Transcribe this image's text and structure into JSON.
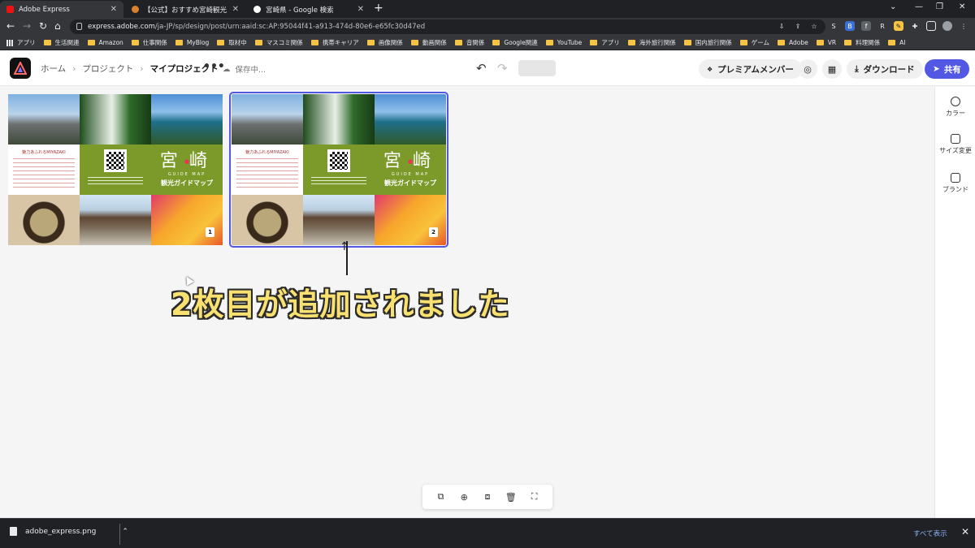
{
  "browser": {
    "tabs": [
      {
        "title": "Adobe Express",
        "active": true
      },
      {
        "title": "【公式】おすすめ宮崎観光スポット／..."
      },
      {
        "title": "宮崎県 - Google 検索"
      }
    ],
    "url_host": "express.adobe.com",
    "url_path": "/ja-JP/sp/design/post/urn:aaid:sc:AP:95044f41-a913-474d-80e6-e65fc30d47ed",
    "bookmarks": [
      "アプリ",
      "生活関連",
      "Amazon",
      "仕事関係",
      "MyBlog",
      "取材中",
      "マスコミ関係",
      "携帯キャリア",
      "画像関係",
      "動画関係",
      "音関係",
      "Google関連",
      "YouTube",
      "アプリ",
      "海外旅行関係",
      "国内旅行関係",
      "ゲーム",
      "Adobe",
      "VR",
      "料理関係",
      "AI"
    ]
  },
  "header": {
    "breadcrumbs": [
      "ホーム",
      "プロジェクト",
      "マイプロジェクト"
    ],
    "more_label": "•••",
    "saving_text": "保存中...",
    "premium_label": "プレミアムメンバー",
    "download_label": "ダウンロード",
    "share_label": "共有"
  },
  "right_panel": {
    "items": [
      "カラー",
      "サイズ変更",
      "ブランド"
    ]
  },
  "pages": [
    {
      "number": "1"
    },
    {
      "number": "2"
    }
  ],
  "design": {
    "title_top": "宮",
    "title_bottom": "崎",
    "guide_en": "GUIDE MAP",
    "guide_ja": "観光ガイドマップ",
    "catch": "魅力あふれるMIYAZAKI"
  },
  "annotation": {
    "arrow": "↑",
    "text": "2枚目が追加されました"
  },
  "download_shelf": {
    "filename": "adobe_express.png",
    "show_all": "すべて表示"
  },
  "colors": {
    "accent": "#5258e4",
    "annotation_fill": "#f8e071",
    "design_green": "#7c9a2a"
  }
}
